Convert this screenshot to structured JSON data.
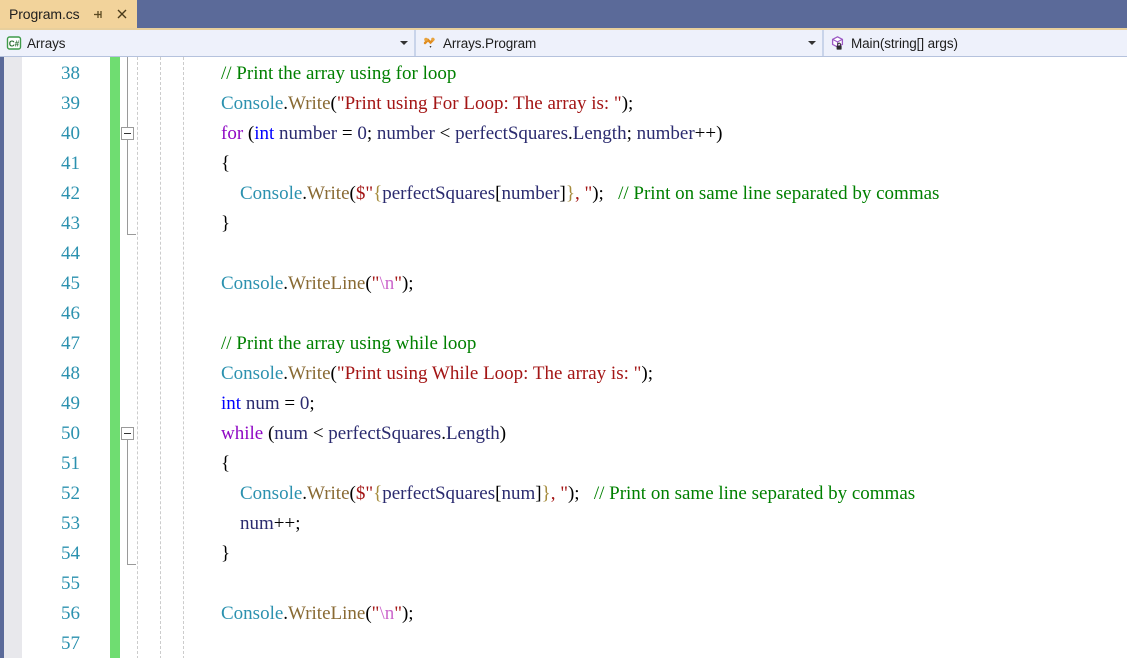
{
  "window": {
    "tab": {
      "filename": "Program.cs",
      "pin_icon": "pin-icon",
      "close_icon": "close-icon"
    },
    "accent_color": "#5b6a99",
    "tab_color": "#f2d39b"
  },
  "navbar": {
    "project": {
      "icon": "csharp-file-icon",
      "label": "Arrays"
    },
    "type": {
      "icon": "class-icon",
      "label": "Arrays.Program"
    },
    "member": {
      "icon": "method-private-icon",
      "label": "Main(string[] args)"
    }
  },
  "editor": {
    "change_bar_color": "#6fdd71",
    "linenumber_color": "#2b91af",
    "first_line": 38,
    "lines": [
      {
        "number": "38",
        "tokens": [
          {
            "t": "    ",
            "c": "plain"
          },
          {
            "t": "// Print the array using for loop",
            "c": "comment"
          }
        ]
      },
      {
        "number": "39",
        "tokens": [
          {
            "t": "    ",
            "c": "plain"
          },
          {
            "t": "Console",
            "c": "class"
          },
          {
            "t": ".",
            "c": "punct"
          },
          {
            "t": "Write",
            "c": "method"
          },
          {
            "t": "(",
            "c": "punct"
          },
          {
            "t": "\"Print using For Loop: The array is: \"",
            "c": "string"
          },
          {
            "t": ");",
            "c": "punct"
          }
        ]
      },
      {
        "number": "40",
        "tokens": [
          {
            "t": "    ",
            "c": "plain"
          },
          {
            "t": "for",
            "c": "ctrl"
          },
          {
            "t": " (",
            "c": "punct"
          },
          {
            "t": "int",
            "c": "keyword"
          },
          {
            "t": " number",
            "c": "plain"
          },
          {
            "t": " = ",
            "c": "punct"
          },
          {
            "t": "0",
            "c": "plain"
          },
          {
            "t": "; ",
            "c": "punct"
          },
          {
            "t": "number",
            "c": "plain"
          },
          {
            "t": " < ",
            "c": "punct"
          },
          {
            "t": "perfectSquares",
            "c": "plain"
          },
          {
            "t": ".",
            "c": "punct"
          },
          {
            "t": "Length",
            "c": "plain"
          },
          {
            "t": "; ",
            "c": "punct"
          },
          {
            "t": "number",
            "c": "plain"
          },
          {
            "t": "++)",
            "c": "punct"
          }
        ]
      },
      {
        "number": "41",
        "tokens": [
          {
            "t": "    ",
            "c": "plain"
          },
          {
            "t": "{",
            "c": "punct"
          }
        ]
      },
      {
        "number": "42",
        "tokens": [
          {
            "t": "        ",
            "c": "plain"
          },
          {
            "t": "Console",
            "c": "class"
          },
          {
            "t": ".",
            "c": "punct"
          },
          {
            "t": "Write",
            "c": "method"
          },
          {
            "t": "(",
            "c": "punct"
          },
          {
            "t": "$\"",
            "c": "string"
          },
          {
            "t": "{",
            "c": "brace"
          },
          {
            "t": "perfectSquares",
            "c": "plain"
          },
          {
            "t": "[",
            "c": "punct"
          },
          {
            "t": "number",
            "c": "plain"
          },
          {
            "t": "]",
            "c": "punct"
          },
          {
            "t": "}",
            "c": "brace"
          },
          {
            "t": ", \"",
            "c": "string"
          },
          {
            "t": ");",
            "c": "punct"
          },
          {
            "t": "   ",
            "c": "plain"
          },
          {
            "t": "// Print on same line separated by commas",
            "c": "comment"
          }
        ]
      },
      {
        "number": "43",
        "tokens": [
          {
            "t": "    ",
            "c": "plain"
          },
          {
            "t": "}",
            "c": "punct"
          }
        ]
      },
      {
        "number": "44",
        "tokens": []
      },
      {
        "number": "45",
        "tokens": [
          {
            "t": "    ",
            "c": "plain"
          },
          {
            "t": "Console",
            "c": "class"
          },
          {
            "t": ".",
            "c": "punct"
          },
          {
            "t": "WriteLine",
            "c": "method"
          },
          {
            "t": "(",
            "c": "punct"
          },
          {
            "t": "\"",
            "c": "string"
          },
          {
            "t": "\\n",
            "c": "escape"
          },
          {
            "t": "\"",
            "c": "string"
          },
          {
            "t": ");",
            "c": "punct"
          }
        ]
      },
      {
        "number": "46",
        "tokens": []
      },
      {
        "number": "47",
        "tokens": [
          {
            "t": "    ",
            "c": "plain"
          },
          {
            "t": "// Print the array using while loop",
            "c": "comment"
          }
        ]
      },
      {
        "number": "48",
        "tokens": [
          {
            "t": "    ",
            "c": "plain"
          },
          {
            "t": "Console",
            "c": "class"
          },
          {
            "t": ".",
            "c": "punct"
          },
          {
            "t": "Write",
            "c": "method"
          },
          {
            "t": "(",
            "c": "punct"
          },
          {
            "t": "\"Print using While Loop: The array is: \"",
            "c": "string"
          },
          {
            "t": ");",
            "c": "punct"
          }
        ]
      },
      {
        "number": "49",
        "tokens": [
          {
            "t": "    ",
            "c": "plain"
          },
          {
            "t": "int",
            "c": "keyword"
          },
          {
            "t": " num",
            "c": "plain"
          },
          {
            "t": " = ",
            "c": "punct"
          },
          {
            "t": "0",
            "c": "plain"
          },
          {
            "t": ";",
            "c": "punct"
          }
        ]
      },
      {
        "number": "50",
        "tokens": [
          {
            "t": "    ",
            "c": "plain"
          },
          {
            "t": "while",
            "c": "ctrl"
          },
          {
            "t": " (",
            "c": "punct"
          },
          {
            "t": "num",
            "c": "plain"
          },
          {
            "t": " < ",
            "c": "punct"
          },
          {
            "t": "perfectSquares",
            "c": "plain"
          },
          {
            "t": ".",
            "c": "punct"
          },
          {
            "t": "Length",
            "c": "plain"
          },
          {
            "t": ")",
            "c": "punct"
          }
        ]
      },
      {
        "number": "51",
        "tokens": [
          {
            "t": "    ",
            "c": "plain"
          },
          {
            "t": "{",
            "c": "punct"
          }
        ]
      },
      {
        "number": "52",
        "tokens": [
          {
            "t": "        ",
            "c": "plain"
          },
          {
            "t": "Console",
            "c": "class"
          },
          {
            "t": ".",
            "c": "punct"
          },
          {
            "t": "Write",
            "c": "method"
          },
          {
            "t": "(",
            "c": "punct"
          },
          {
            "t": "$\"",
            "c": "string"
          },
          {
            "t": "{",
            "c": "brace"
          },
          {
            "t": "perfectSquares",
            "c": "plain"
          },
          {
            "t": "[",
            "c": "punct"
          },
          {
            "t": "num",
            "c": "plain"
          },
          {
            "t": "]",
            "c": "punct"
          },
          {
            "t": "}",
            "c": "brace"
          },
          {
            "t": ", \"",
            "c": "string"
          },
          {
            "t": ");",
            "c": "punct"
          },
          {
            "t": "   ",
            "c": "plain"
          },
          {
            "t": "// Print on same line separated by commas",
            "c": "comment"
          }
        ]
      },
      {
        "number": "53",
        "tokens": [
          {
            "t": "        ",
            "c": "plain"
          },
          {
            "t": "num",
            "c": "plain"
          },
          {
            "t": "++;",
            "c": "punct"
          }
        ]
      },
      {
        "number": "54",
        "tokens": [
          {
            "t": "    ",
            "c": "plain"
          },
          {
            "t": "}",
            "c": "punct"
          }
        ]
      },
      {
        "number": "55",
        "tokens": []
      },
      {
        "number": "56",
        "tokens": [
          {
            "t": "    ",
            "c": "plain"
          },
          {
            "t": "Console",
            "c": "class"
          },
          {
            "t": ".",
            "c": "punct"
          },
          {
            "t": "WriteLine",
            "c": "method"
          },
          {
            "t": "(",
            "c": "punct"
          },
          {
            "t": "\"",
            "c": "string"
          },
          {
            "t": "\\n",
            "c": "escape"
          },
          {
            "t": "\"",
            "c": "string"
          },
          {
            "t": ");",
            "c": "punct"
          }
        ]
      },
      {
        "number": "57",
        "tokens": []
      }
    ],
    "fold_regions": [
      {
        "start_line": "40",
        "end_line": "43"
      },
      {
        "start_line": "50",
        "end_line": "54"
      }
    ],
    "indent_guide_x": [
      137,
      160,
      183
    ]
  }
}
